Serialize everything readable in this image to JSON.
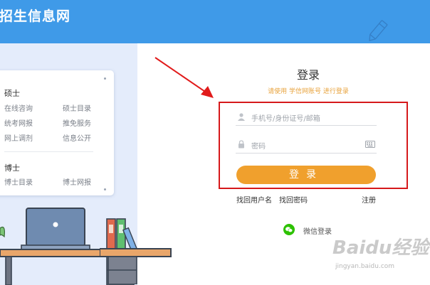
{
  "header": {
    "site_title": "招生信息网"
  },
  "left_card": {
    "master": {
      "title": "硕士",
      "links": [
        "在线咨询",
        "硕士目录",
        "统考网报",
        "推免服务",
        "网上调剂",
        "信息公开"
      ]
    },
    "doctor": {
      "title": "博士",
      "links": [
        "博士目录",
        "博士网报"
      ]
    }
  },
  "login": {
    "title": "登录",
    "subtitle": "请使用 学信网账号 进行登录",
    "username_placeholder": "手机号/身份证号/邮箱",
    "password_placeholder": "密码",
    "button_label": "登录",
    "find_username": "找回用户名",
    "find_password": "找回密码",
    "register": "注册",
    "wechat_login": "微信登录"
  },
  "colors": {
    "header_blue": "#3f9ae8",
    "button_orange": "#f0a02d",
    "highlight_red": "#d6191b",
    "wechat_green": "#2dc100"
  },
  "watermark": {
    "brand": "Baidu经验",
    "url": "jingyan.baidu.com"
  }
}
